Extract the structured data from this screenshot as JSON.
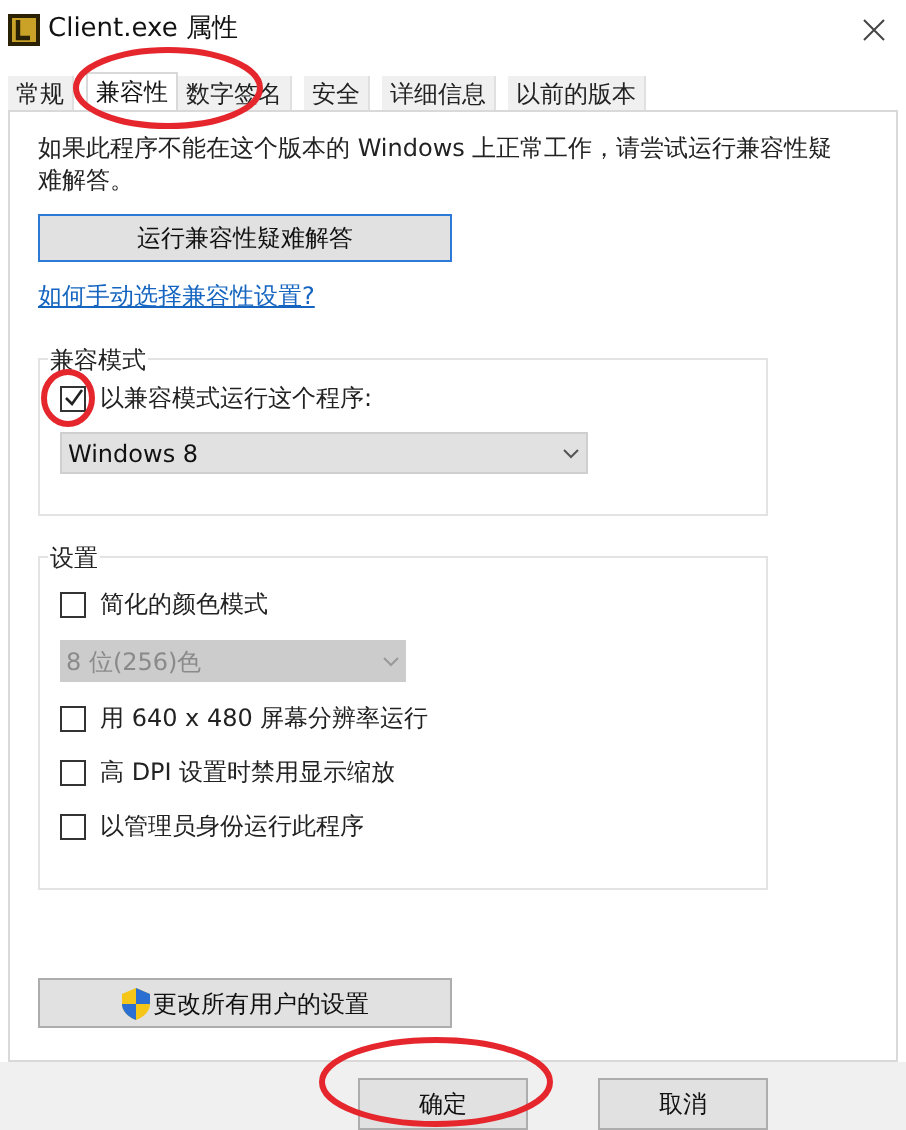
{
  "window": {
    "title": "Client.exe 属性"
  },
  "tabs": [
    {
      "label": "常规",
      "selected": false
    },
    {
      "label": "兼容性",
      "selected": true
    },
    {
      "label": "数字签名",
      "selected": false
    },
    {
      "label": "安全",
      "selected": false
    },
    {
      "label": "详细信息",
      "selected": false
    },
    {
      "label": "以前的版本",
      "selected": false
    }
  ],
  "intro": "如果此程序不能在这个版本的 Windows 上正常工作，请尝试运行兼容性疑难解答。",
  "troubleshoot_button": "运行兼容性疑难解答",
  "help_link": "如何手动选择兼容性设置?",
  "compat_group": {
    "title": "兼容模式",
    "checkbox": {
      "label": "以兼容模式运行这个程序:",
      "checked": true
    },
    "dropdown": {
      "value": "Windows 8",
      "disabled": false
    }
  },
  "settings_group": {
    "title": "设置",
    "items": [
      {
        "kind": "checkbox",
        "label": "简化的颜色模式",
        "checked": false
      },
      {
        "kind": "dropdown",
        "value": "8 位(256)色",
        "disabled": true
      },
      {
        "kind": "checkbox",
        "label": "用 640 x 480 屏幕分辨率运行",
        "checked": false
      },
      {
        "kind": "checkbox",
        "label": "高 DPI 设置时禁用显示缩放",
        "checked": false
      },
      {
        "kind": "checkbox",
        "label": "以管理员身份运行此程序",
        "checked": false
      }
    ]
  },
  "all_users_button": "更改所有用户的设置",
  "footer_buttons": [
    "确定",
    "取消"
  ]
}
